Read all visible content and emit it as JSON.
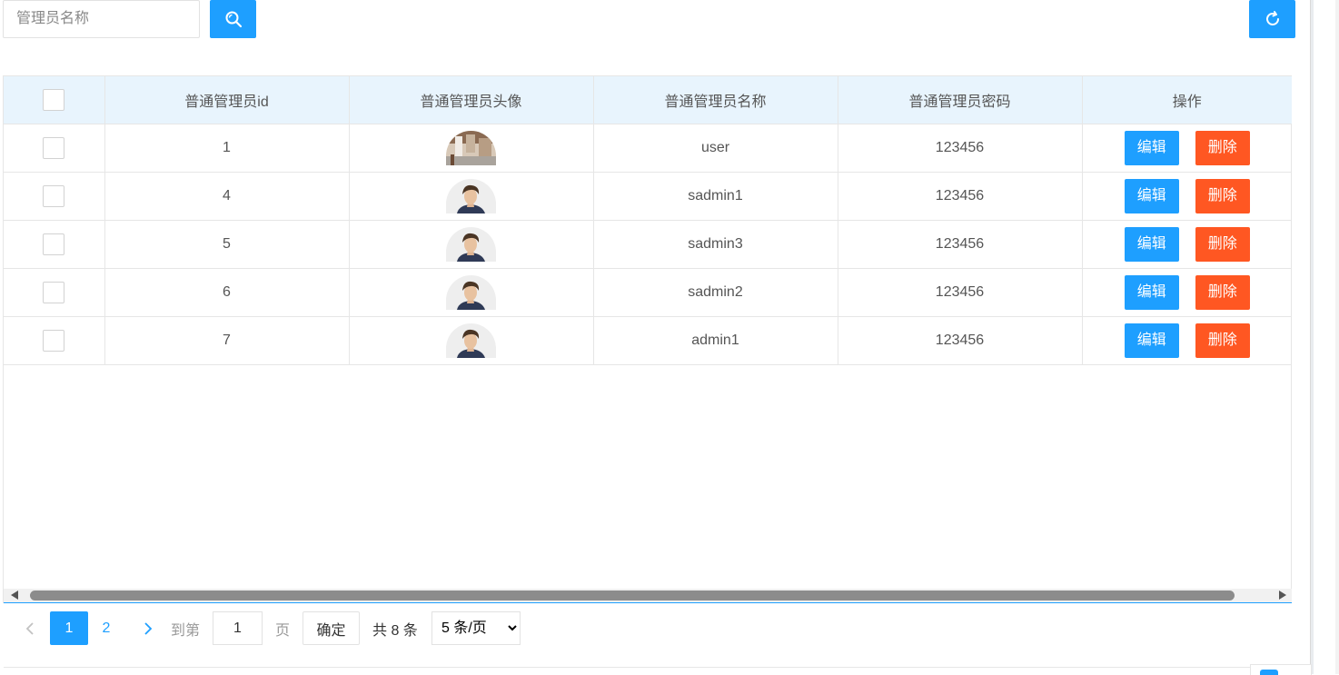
{
  "search": {
    "placeholder": "管理员名称",
    "search_icon": "search-icon",
    "refresh_icon": "refresh-icon"
  },
  "table": {
    "headers": [
      "普通管理员id",
      "普通管理员头像",
      "普通管理员名称",
      "普通管理员密码",
      "操作"
    ],
    "rows": [
      {
        "id": "1",
        "avatar": "photo-avatar",
        "name": "user",
        "password": "123456"
      },
      {
        "id": "4",
        "avatar": "person-avatar",
        "name": "sadmin1",
        "password": "123456"
      },
      {
        "id": "5",
        "avatar": "person-avatar",
        "name": "sadmin3",
        "password": "123456"
      },
      {
        "id": "6",
        "avatar": "person-avatar",
        "name": "sadmin2",
        "password": "123456"
      },
      {
        "id": "7",
        "avatar": "person-avatar",
        "name": "admin1",
        "password": "123456"
      }
    ],
    "edit_label": "编辑",
    "delete_label": "删除"
  },
  "pagination": {
    "current_page": "1",
    "page_2": "2",
    "goto_label": "到第",
    "goto_value": "1",
    "page_label": "页",
    "confirm_label": "确定",
    "total_label": "共 8 条",
    "page_size_selected": "5 条/页",
    "prev_icon": "chevron-left-icon",
    "next_icon": "chevron-right-icon"
  },
  "colors": {
    "primary": "#1e9fff",
    "danger": "#ff5722",
    "header_bg": "#e8f4fd"
  }
}
